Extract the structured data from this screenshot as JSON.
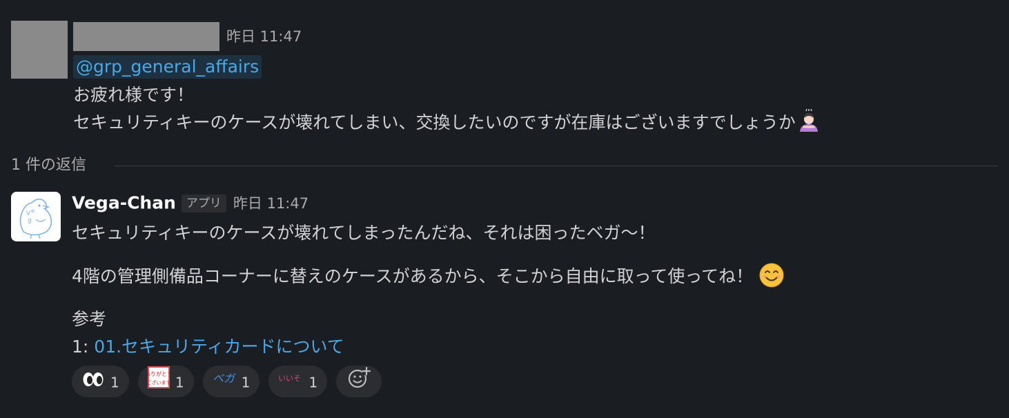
{
  "message1": {
    "timestamp": "昨日 11:47",
    "mention": "@grp_general_affairs",
    "lines": [
      "お疲れ様です！",
      "セキュリティキーのケースが壊れてしまい、交換したいのですが在庫はございますでしょうか"
    ],
    "trailing_emoji": "person-bowing-icon"
  },
  "thread": {
    "reply_count_label": "1 件の返信"
  },
  "message2": {
    "bot_name": "Vega-Chan",
    "badge": "アプリ",
    "timestamp": "昨日 11:47",
    "para1": "セキュリティキーのケースが壊れてしまったんだね、それは困ったベガ〜！",
    "para2": "4階の管理側備品コーナーに替えのケースがあるから、そこから自由に取って使ってね！",
    "para2_emoji": "smiling-face-icon",
    "ref_title": "参考",
    "ref_index": "1:",
    "ref_link": "01.セキュリティカードについて"
  },
  "reactions": [
    {
      "icon": "eyes-icon",
      "count": "1"
    },
    {
      "icon": "arigatou-gozaimasu-stamp-icon",
      "icon_text": "ありがとう ございます",
      "count": "1"
    },
    {
      "icon": "vega-stamp-icon",
      "icon_text": "ベガ〜",
      "count": "1"
    },
    {
      "icon": "iiso-stamp-icon",
      "icon_text": "いいそ",
      "count": "1"
    }
  ],
  "add_reaction_icon": "add-reaction-icon",
  "colors": {
    "background": "#1a1d21",
    "link": "#4aa8e8",
    "mention_bg": "#1d3140",
    "text": "#d1d2d3"
  }
}
